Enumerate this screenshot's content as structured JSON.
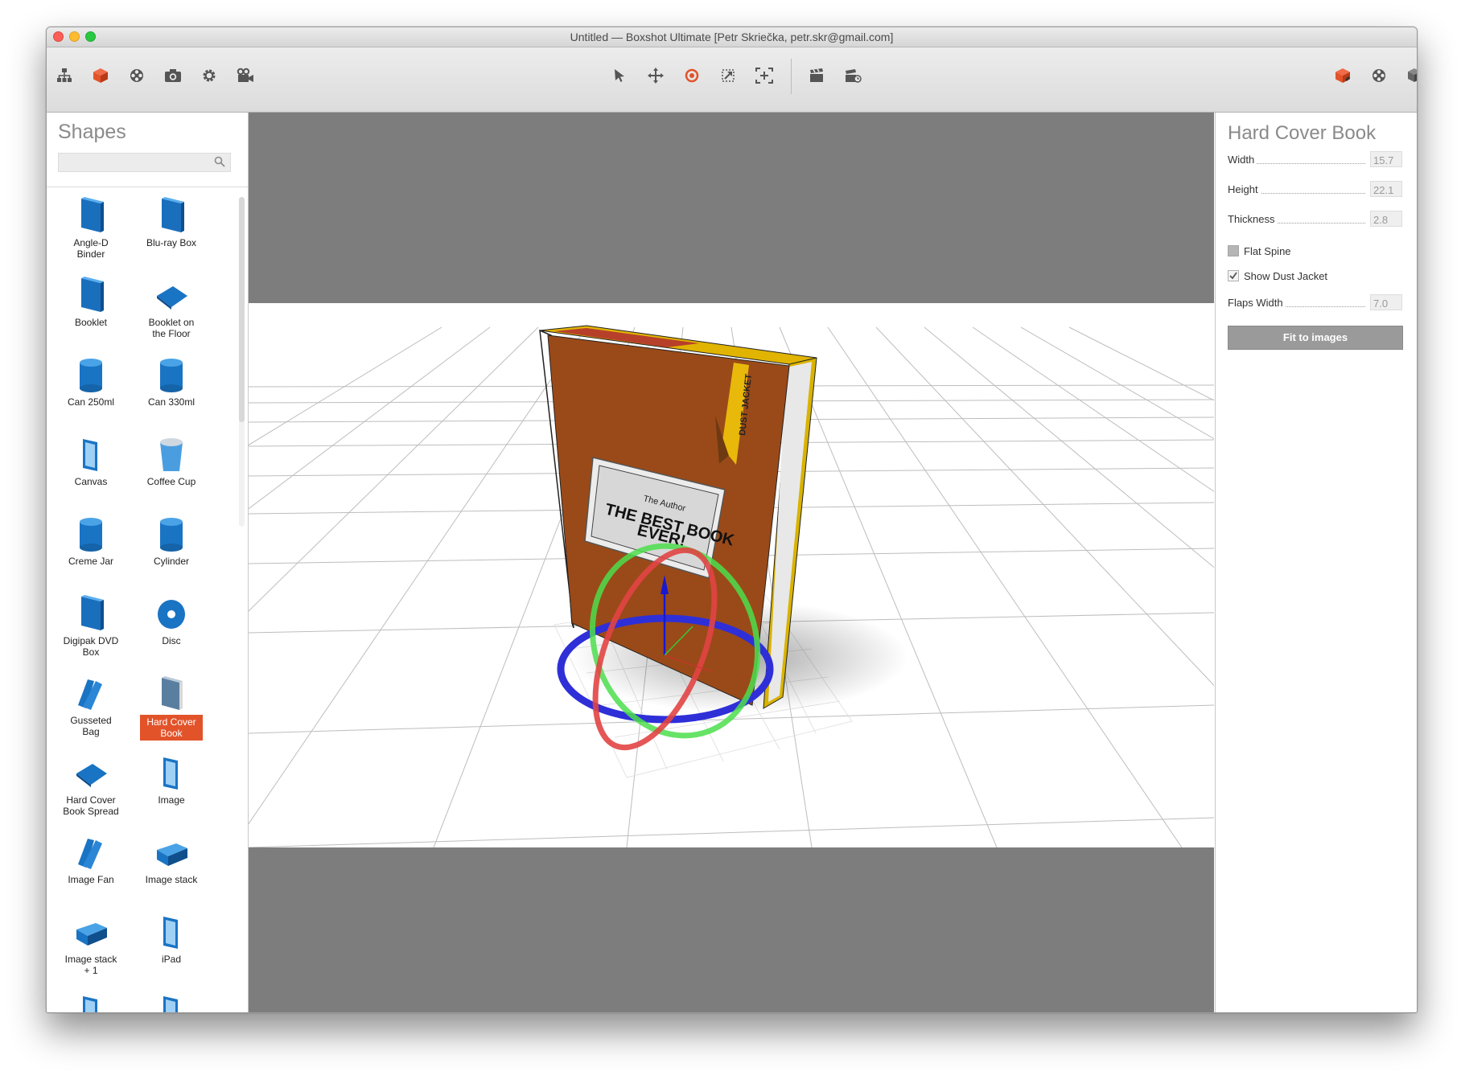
{
  "window": {
    "title": "Untitled — Boxshot Ultimate [Petr Skriečka, petr.skr@gmail.com]"
  },
  "toolbar": {
    "left_icons": [
      "hierarchy-icon",
      "cube-icon",
      "materials-icon",
      "camera-icon",
      "settings-icon",
      "video-camera-icon"
    ],
    "center_icons": [
      "pointer-icon",
      "move-icon",
      "rotate-icon",
      "scale-icon",
      "fit-frame-icon",
      "clapper-icon",
      "render-icon"
    ],
    "right_icons": [
      "shape-icon",
      "material-icon",
      "add-box-icon"
    ],
    "accent_color": "#e2532a"
  },
  "shapes_panel": {
    "title": "Shapes",
    "search": {
      "value": "",
      "placeholder": ""
    },
    "items": [
      {
        "label": "Angle-D\nBinder",
        "icon": "binder-icon",
        "selected": false
      },
      {
        "label": "Blu-ray Box",
        "icon": "bluray-box-icon",
        "selected": false
      },
      {
        "label": "Booklet",
        "icon": "booklet-icon",
        "selected": false
      },
      {
        "label": "Booklet on\nthe Floor",
        "icon": "booklet-floor-icon",
        "selected": false
      },
      {
        "label": "Can 250ml",
        "icon": "can-250-icon",
        "selected": false
      },
      {
        "label": "Can 330ml",
        "icon": "can-330-icon",
        "selected": false
      },
      {
        "label": "Canvas",
        "icon": "canvas-icon",
        "selected": false
      },
      {
        "label": "Coffee Cup",
        "icon": "coffee-cup-icon",
        "selected": false
      },
      {
        "label": "Creme Jar",
        "icon": "creme-jar-icon",
        "selected": false
      },
      {
        "label": "Cylinder",
        "icon": "cylinder-icon",
        "selected": false
      },
      {
        "label": "Digipak DVD\nBox",
        "icon": "digipak-icon",
        "selected": false
      },
      {
        "label": "Disc",
        "icon": "disc-icon",
        "selected": false
      },
      {
        "label": "Gusseted Bag",
        "icon": "gusseted-bag-icon",
        "selected": false
      },
      {
        "label": "Hard Cover\nBook",
        "icon": "hard-cover-book-icon",
        "selected": true
      },
      {
        "label": "Hard Cover\nBook Spread",
        "icon": "book-spread-icon",
        "selected": false
      },
      {
        "label": "Image",
        "icon": "image-icon",
        "selected": false
      },
      {
        "label": "Image Fan",
        "icon": "image-fan-icon",
        "selected": false
      },
      {
        "label": "Image stack",
        "icon": "image-stack-icon",
        "selected": false
      },
      {
        "label": "Image stack\n+ 1",
        "icon": "image-stack-plus-icon",
        "selected": false
      },
      {
        "label": "iPad",
        "icon": "ipad-icon",
        "selected": false
      },
      {
        "label": "",
        "icon": "phone-icon",
        "selected": false
      },
      {
        "label": "",
        "icon": "tablet-icon",
        "selected": false
      }
    ]
  },
  "viewport": {
    "book": {
      "author": "The Author",
      "title_line1": "THE BEST BOOK",
      "title_line2": "EVER!",
      "ribbon": "DUST JACKET"
    }
  },
  "properties": {
    "title": "Hard Cover Book",
    "fields": [
      {
        "label": "Width",
        "value": "15.7"
      },
      {
        "label": "Height",
        "value": "22.1"
      },
      {
        "label": "Thickness",
        "value": "2.8"
      }
    ],
    "checkboxes": [
      {
        "label": "Flat Spine",
        "checked": false
      },
      {
        "label": "Show Dust Jacket",
        "checked": true
      }
    ],
    "flaps": {
      "label": "Flaps Width",
      "value": "7.0"
    },
    "fit_button": "Fit to images"
  }
}
